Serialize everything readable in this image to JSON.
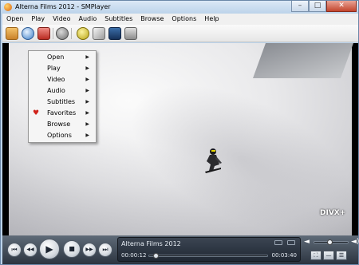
{
  "window": {
    "title": "Alterna Films 2012 - SMPlayer",
    "minimize_glyph": "–",
    "maximize_glyph": "□",
    "close_glyph": "✕"
  },
  "menubar": [
    "Open",
    "Play",
    "Video",
    "Audio",
    "Subtitles",
    "Browse",
    "Options",
    "Help"
  ],
  "toolbar": {
    "icons": [
      "open-folder-icon",
      "open-url-icon",
      "favorites-icon",
      "stop-record-icon",
      "info-icon",
      "tools-icon",
      "full-screen-icon",
      "compact-mode-icon"
    ]
  },
  "context_menu": {
    "items": [
      {
        "label": "Open",
        "icon": ""
      },
      {
        "label": "Play",
        "icon": ""
      },
      {
        "label": "Video",
        "icon": ""
      },
      {
        "label": "Audio",
        "icon": ""
      },
      {
        "label": "Subtitles",
        "icon": ""
      },
      {
        "label": "Favorites",
        "icon": "heart-icon"
      },
      {
        "label": "Browse",
        "icon": ""
      },
      {
        "label": "Options",
        "icon": ""
      }
    ],
    "arrow": "▶",
    "heart": "♥"
  },
  "video": {
    "watermark": "DIVX+"
  },
  "controls": {
    "prev_glyph": "⏮",
    "rew_glyph": "◀◀",
    "play_glyph": "▶",
    "stop_glyph": "■",
    "fwd_glyph": "▶▶",
    "next_glyph": "⏭",
    "media_title": "Alterna Films 2012",
    "time_current": "00:00:12",
    "time_total": "00:03:40",
    "seek_position": 0.055,
    "volume_level": 0.45,
    "volume_low_glyph": "◄",
    "volume_high_glyph": "◄)",
    "fullscreen_glyph": "⛶",
    "compact_glyph": "—",
    "playlist_glyph": "☰"
  },
  "colors": {
    "titlebar": "#bcd3ea",
    "controls_bg": "#2c3440",
    "favorites_heart": "#d0231b"
  }
}
